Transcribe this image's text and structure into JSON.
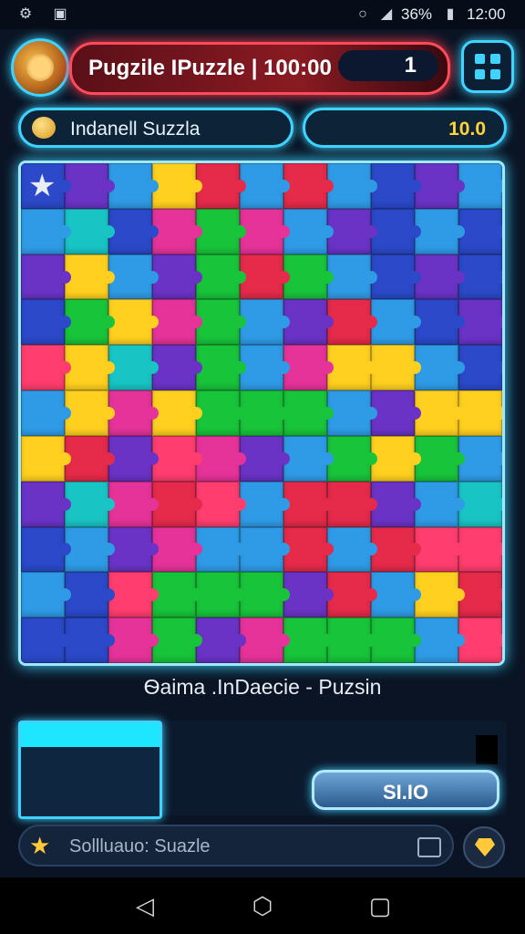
{
  "status_bar": {
    "battery": "36%",
    "time": "12:00"
  },
  "header": {
    "title": "Pugzile IPuzzle | 100:00",
    "level": "1"
  },
  "info": {
    "left_label": "Indanell Suzzla",
    "right_value": "10.0"
  },
  "board": {
    "colors": [
      [
        "#2b49c9",
        "#6a33c6",
        "#2f9be6",
        "#ffd01f",
        "#e52a4a",
        "#2f9be6",
        "#e52a4a",
        "#2f9be6",
        "#2b49c9",
        "#6a33c6",
        "#2f9be6"
      ],
      [
        "#2f9be6",
        "#19c4c4",
        "#2b49c9",
        "#e5339a",
        "#18c43a",
        "#e5339a",
        "#2f9be6",
        "#6a33c6",
        "#2b49c9",
        "#2f9be6",
        "#2b49c9"
      ],
      [
        "#6a33c6",
        "#ffd01f",
        "#2f9be6",
        "#6a33c6",
        "#18c43a",
        "#e52a4a",
        "#18c43a",
        "#2f9be6",
        "#2b49c9",
        "#6a33c6",
        "#2b49c9"
      ],
      [
        "#2b49c9",
        "#18c43a",
        "#ffd01f",
        "#e5339a",
        "#18c43a",
        "#2f9be6",
        "#6a33c6",
        "#e52a4a",
        "#2f9be6",
        "#2b49c9",
        "#6a33c6"
      ],
      [
        "#ff3d6e",
        "#ffd01f",
        "#19c4c4",
        "#6a33c6",
        "#18c43a",
        "#2f9be6",
        "#e5339a",
        "#ffd01f",
        "#ffd01f",
        "#2f9be6",
        "#2b49c9"
      ],
      [
        "#2f9be6",
        "#ffd01f",
        "#e5339a",
        "#ffd01f",
        "#18c43a",
        "#18c43a",
        "#18c43a",
        "#2f9be6",
        "#6a33c6",
        "#ffd01f",
        "#ffd01f"
      ],
      [
        "#ffd01f",
        "#e52a4a",
        "#6a33c6",
        "#ff3d6e",
        "#e5339a",
        "#6a33c6",
        "#2f9be6",
        "#18c43a",
        "#ffd01f",
        "#18c43a",
        "#2f9be6"
      ],
      [
        "#6a33c6",
        "#19c4c4",
        "#e5339a",
        "#e52a4a",
        "#ff3d6e",
        "#2f9be6",
        "#e52a4a",
        "#e52a4a",
        "#6a33c6",
        "#2f9be6",
        "#19c4c4"
      ],
      [
        "#2b49c9",
        "#2f9be6",
        "#6a33c6",
        "#e5339a",
        "#2f9be6",
        "#2f9be6",
        "#e52a4a",
        "#2f9be6",
        "#e52a4a",
        "#ff3d6e",
        "#ff3d6e"
      ],
      [
        "#2f9be6",
        "#2b49c9",
        "#ff3d6e",
        "#18c43a",
        "#18c43a",
        "#18c43a",
        "#6a33c6",
        "#e52a4a",
        "#2f9be6",
        "#ffd01f",
        "#e52a4a"
      ],
      [
        "#2b49c9",
        "#2b49c9",
        "#e5339a",
        "#18c43a",
        "#6a33c6",
        "#e5339a",
        "#18c43a",
        "#18c43a",
        "#18c43a",
        "#2f9be6",
        "#ff3d6e"
      ]
    ]
  },
  "caption": "Ѳaima .InDaecie - Puzsin",
  "action_button": {
    "label": "ЅI.IO"
  },
  "bottom_bar": {
    "text": "Sollluauo: Suazle"
  },
  "icons": {
    "gear": "gear-icon",
    "photo": "photo-icon",
    "wifi": "wifi-icon",
    "signal": "signal-icon",
    "battery": "battery-icon",
    "menu": "grid-menu-icon",
    "coin": "coin-icon",
    "star": "star-icon",
    "gem": "gem-icon",
    "back": "back-icon",
    "home": "home-icon",
    "recents": "recents-icon"
  }
}
